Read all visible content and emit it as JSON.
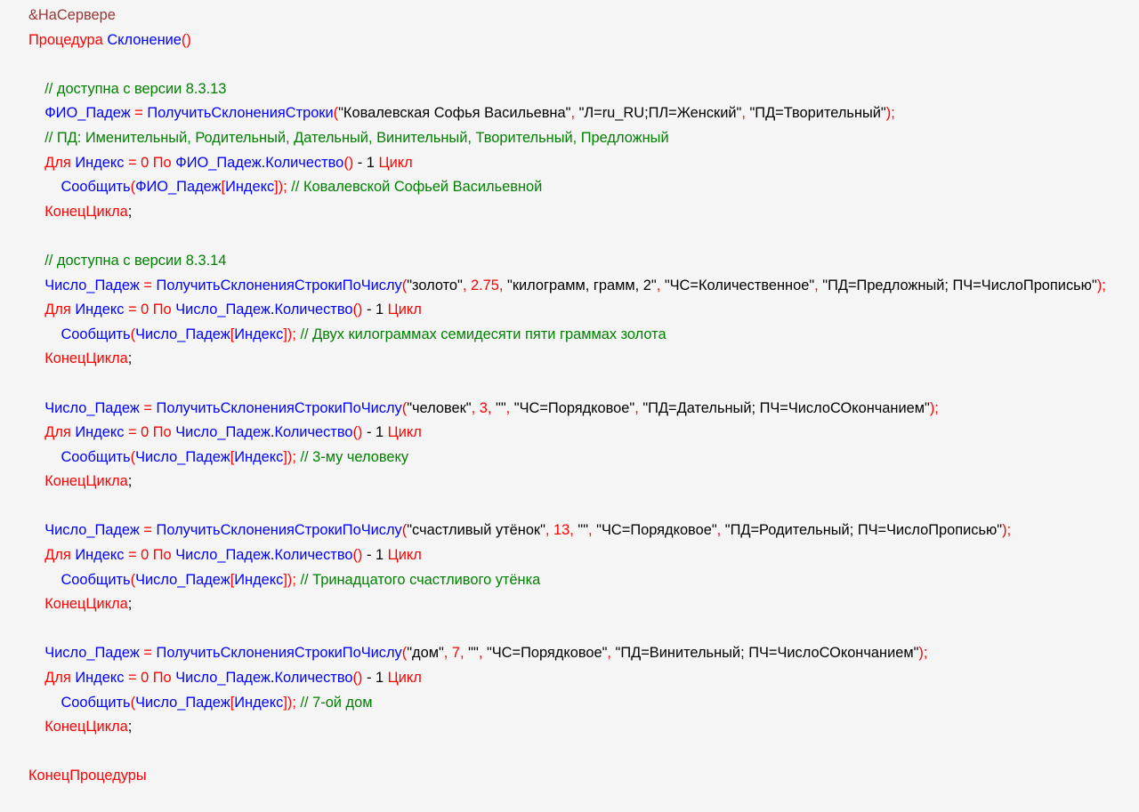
{
  "code": {
    "directive": "&НаСервере",
    "proc_kw": "Процедура",
    "proc_name": "Склонение",
    "endproc": "КонецПроцедуры",
    "c1": "// доступна с версии 8.3.13",
    "v_fio": "ФИО_Падеж",
    "eq": "=",
    "fn1": "ПолучитьСклоненияСтроки",
    "s1a": "\"Ковалевская Софья Васильевна\"",
    "s1b": "\"Л=ru_RU;ПЛ=Женский\"",
    "s1c": "\"ПД=Творительный\"",
    "c2": "// ПД: Именительный, Родительный, Дательный, Винительный, Творительный, Предложный",
    "for_kw": "Для",
    "idx": "Индекс",
    "zero": "0",
    "to_kw": "По",
    "count": "Количество",
    "m1": "- 1",
    "loop_kw": "Цикл",
    "report": "Сообщить",
    "endloop": "КонецЦикла",
    "c_out1": "// Ковалевской Софьей Васильевной",
    "c3": "// доступна с версии 8.3.14",
    "v_num": "Число_Падеж",
    "fn2": "ПолучитьСклоненияСтрокиПоЧислу",
    "s2a": "\"золото\"",
    "n2": "2.75",
    "s2b": "\"килограмм, грамм, 2\"",
    "s2c": "\"ЧС=Количественное\"",
    "s2d": "\"ПД=Предложный; ПЧ=ЧислоПрописью\"",
    "c_out2": "// Двух килограммах семидесяти пяти граммах золота",
    "s3a": "\"человек\"",
    "n3": "3",
    "s3b": "\"\"",
    "s3c": "\"ЧС=Порядковое\"",
    "s3d": "\"ПД=Дательный; ПЧ=ЧислоСОкончанием\"",
    "c_out3": "// 3-му человеку",
    "s4a": "\"счастливый утёнок\"",
    "n4": "13",
    "s4c": "\"ЧС=Порядковое\"",
    "s4d": "\"ПД=Родительный; ПЧ=ЧислоПрописью\"",
    "c_out4": "// Тринадцатого счастливого утёнка",
    "s5a": "\"дом\"",
    "n5": "7",
    "s5c": "\"ЧС=Порядковое\"",
    "s5d": "\"ПД=Винительный; ПЧ=ЧислоСОкончанием\"",
    "c_out5": "// 7-ой дом"
  }
}
